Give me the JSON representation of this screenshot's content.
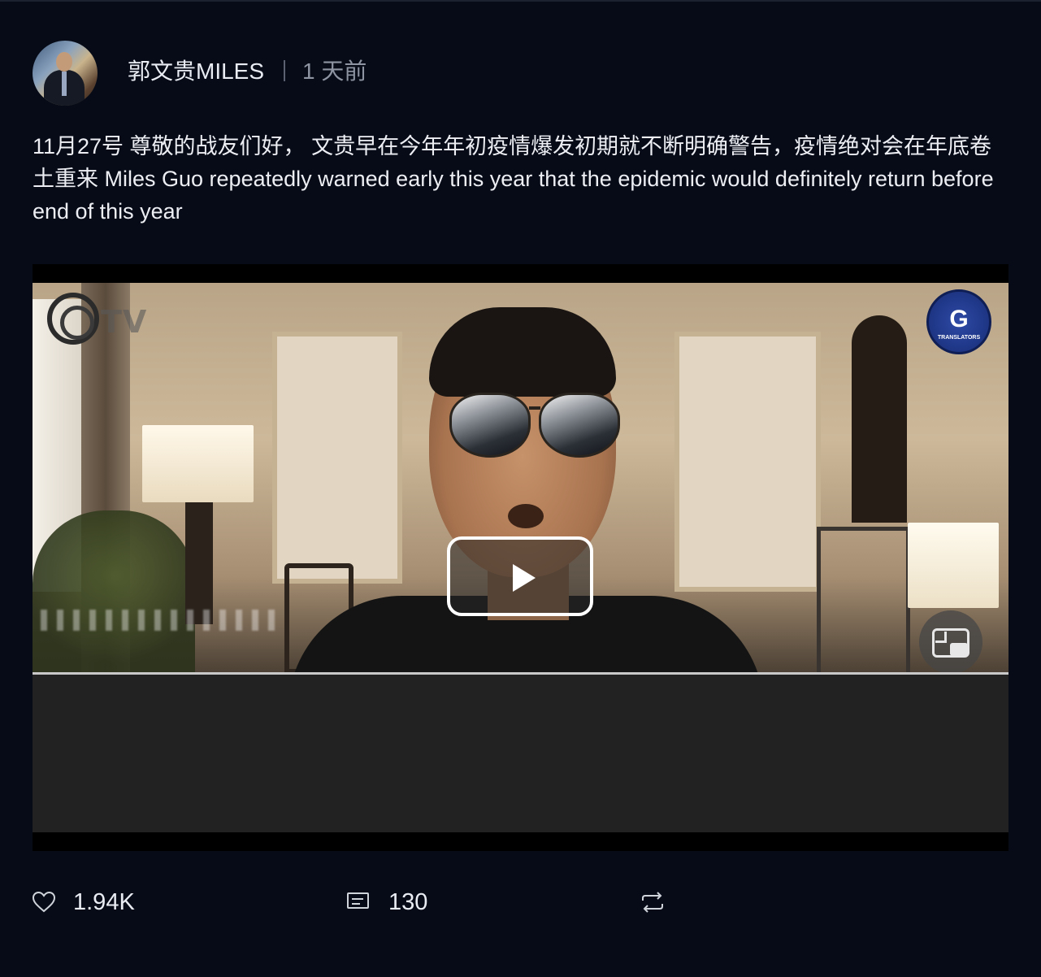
{
  "post": {
    "author_name": "郭文贵MILES",
    "time_ago": "1 天前",
    "text": "11月27号 尊敬的战友们好， 文贵早在今年年初疫情爆发初期就不断明确警告，疫情绝对会在年底卷土重来 Miles Guo repeatedly warned early this year that the epidemic would definitely return before end of this year"
  },
  "video": {
    "channel_logo_text": "TV",
    "badge_letter": "G",
    "badge_subtext": "TRANSLATORS"
  },
  "actions": {
    "likes": "1.94K",
    "comments": "130"
  },
  "icons": {
    "like": "heart-icon",
    "comment": "comment-icon",
    "repost": "repost-icon",
    "play": "play-icon",
    "pip": "picture-in-picture-icon"
  },
  "colors": {
    "background": "#060b17",
    "text": "#e9ecf2",
    "muted": "#8e94a1"
  }
}
